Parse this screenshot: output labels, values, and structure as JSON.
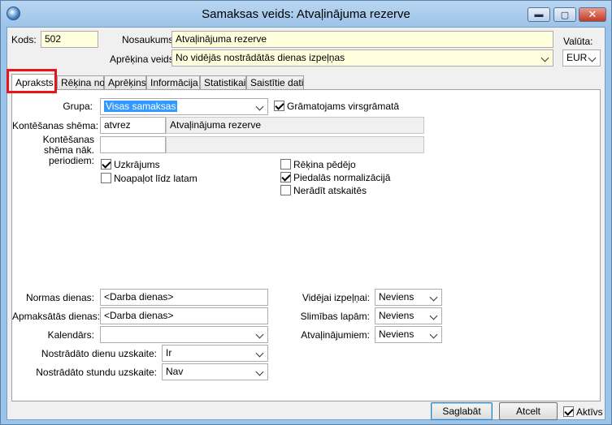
{
  "window": {
    "title": "Samaksas veids: Atvaļinājuma rezerve",
    "minimize_icon": "minimize-icon",
    "maximize_icon": "maximize-icon",
    "close_icon": "close-icon"
  },
  "header": {
    "kods_label": "Kods:",
    "kods_value": "502",
    "nosaukums_label": "Nosaukums:",
    "nosaukums_value": "Atvaļinājuma rezerve",
    "aprekina_veids_label": "Aprēķina veids:",
    "aprekina_veids_value": "No vidējās nostrādātās dienas izpeļņas",
    "valuta_label": "Valūta:",
    "valuta_value": "EUR"
  },
  "tabs": [
    {
      "label": "Apraksts"
    },
    {
      "label": "Rēķina no"
    },
    {
      "label": "Aprēķins"
    },
    {
      "label": "Informācija"
    },
    {
      "label": "Statistikai"
    },
    {
      "label": "Saistītie dati"
    }
  ],
  "apraksts": {
    "grupa_label": "Grupa:",
    "grupa_value": "Visas samaksas",
    "gramatojams_label": "Grāmatojams virsgrāmatā",
    "kontesanas_label": "Kontēšanas shēma:",
    "kontesanas_code": "atvrez",
    "kontesanas_name": "Atvaļinājuma rezerve",
    "kontesanas_nak_label_1": "Kontēšanas",
    "kontesanas_nak_label_2": "shēma nāk.",
    "kontesanas_nak_label_3": "periodiem:",
    "kontesanas_nak_code": "",
    "kontesanas_nak_name": "",
    "uzkrajums_label": "Uzkrājums",
    "noapalot_label": "Noapaļot līdz latam",
    "rekina_pedejo_label": "Rēķina pēdējo",
    "piedalas_label": "Piedalās normalizācijā",
    "neradit_label": "Nerādīt atskaitēs",
    "normas_dienas_label": "Normas dienas:",
    "normas_dienas_value": "<Darba dienas>",
    "apmaksatas_dienas_label": "Apmaksātās dienas:",
    "apmaksatas_dienas_value": "<Darba dienas>",
    "kalendars_label": "Kalendārs:",
    "kalendars_value": "",
    "nostradato_dienu_label": "Nostrādāto dienu uzskaite:",
    "nostradato_dienu_value": "Ir",
    "nostradato_stundu_label": "Nostrādāto stundu uzskaite:",
    "nostradato_stundu_value": "Nav",
    "videjai_label": "Vidējai izpeļņai:",
    "videjai_value": "Neviens",
    "slimibas_label": "Slimības lapām:",
    "slimibas_value": "Neviens",
    "atvalinajumiem_label": "Atvaļinājumiem:",
    "atvalinajumiem_value": "Neviens"
  },
  "footer": {
    "save_label": "Saglabāt",
    "cancel_label": "Atcelt",
    "active_label": "Aktīvs"
  }
}
